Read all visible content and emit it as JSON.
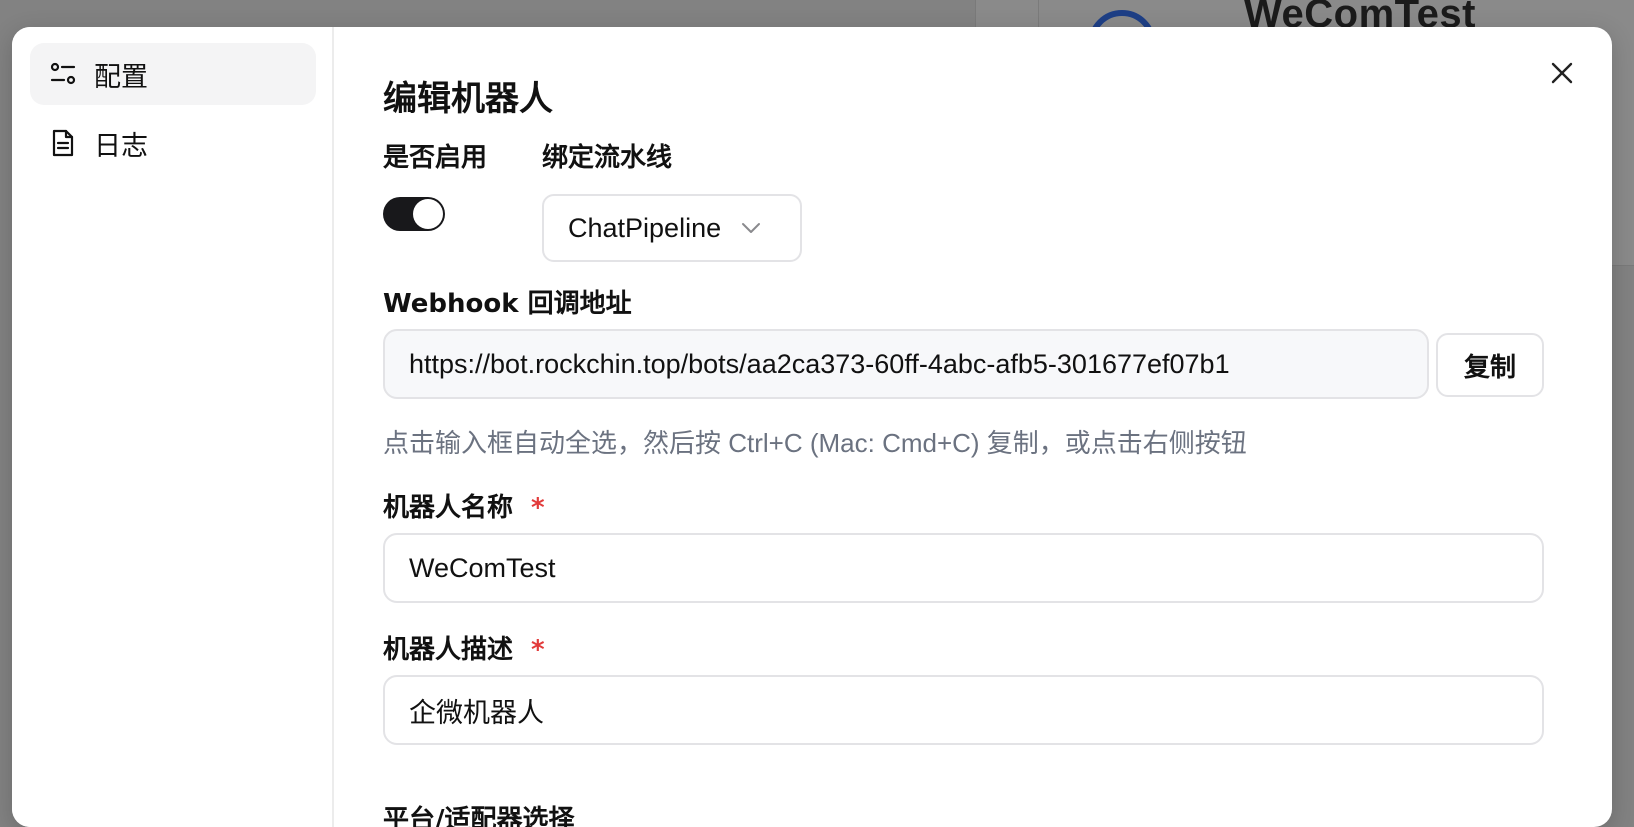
{
  "background_page": {
    "title": "WeComTest"
  },
  "sidebar": {
    "items": [
      {
        "label": "配置",
        "icon": "sliders-icon",
        "active": true
      },
      {
        "label": "日志",
        "icon": "document-icon",
        "active": false
      }
    ]
  },
  "dialog": {
    "title": "编辑机器人",
    "enable": {
      "label": "是否启用",
      "value": true
    },
    "pipeline": {
      "label": "绑定流水线",
      "value": "ChatPipeline"
    },
    "webhook": {
      "label": "Webhook 回调地址",
      "value": "https://bot.rockchin.top/bots/aa2ca373-60ff-4abc-afb5-301677ef07b1",
      "copy_label": "复制",
      "hint": "点击输入框自动全选，然后按 Ctrl+C (Mac: Cmd+C) 复制，或点击右侧按钮"
    },
    "name": {
      "label": "机器人名称",
      "required_mark": "*",
      "value": "WeComTest"
    },
    "description": {
      "label": "机器人描述",
      "required_mark": "*",
      "value": "企微机器人"
    },
    "next_section_label": "平台/适配器选择"
  },
  "colors": {
    "overlay": "#828282",
    "toggle_on": "#18181b",
    "required": "#e23b3b",
    "hint_text": "#6b7280",
    "border": "#e3e3e6"
  }
}
